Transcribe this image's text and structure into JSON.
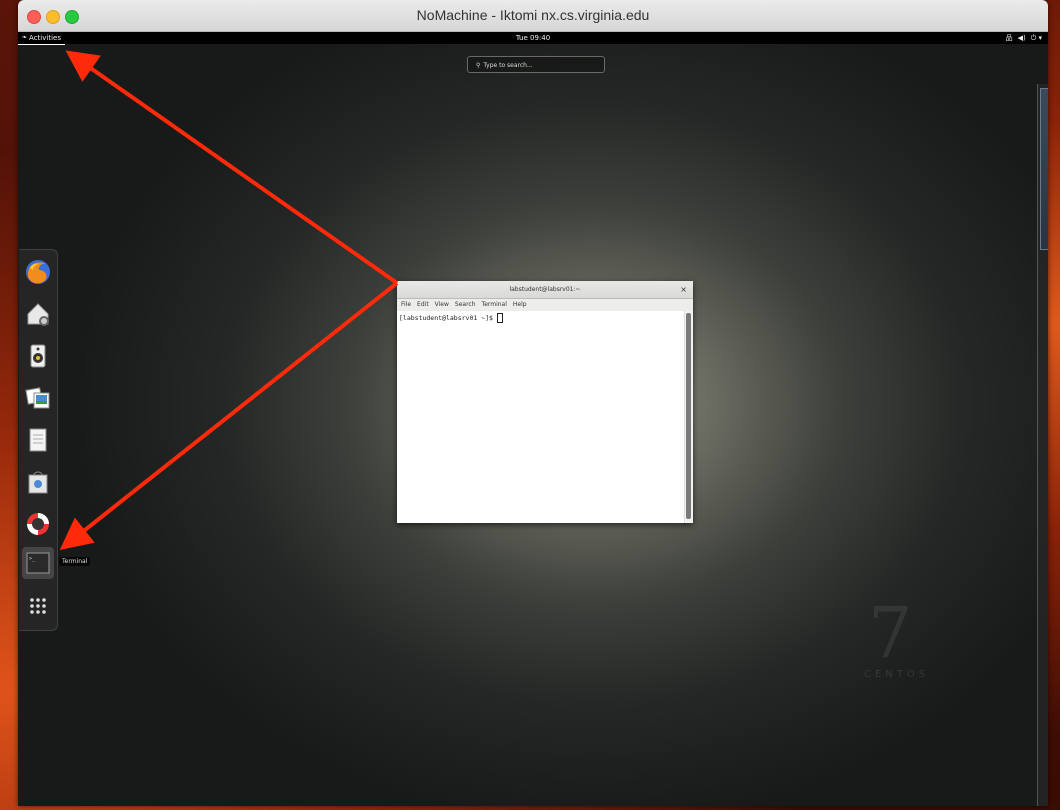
{
  "window": {
    "title": "NoMachine - Iktomi  nx.cs.virginia.edu"
  },
  "topbar": {
    "activities_label": "Activities",
    "clock": "Tue 09:40",
    "tray_icons": [
      "network-icon",
      "volume-icon",
      "power-icon"
    ]
  },
  "search": {
    "placeholder": "Type to search..."
  },
  "dash": {
    "apps": [
      "firefox",
      "network-drive",
      "rhythmbox",
      "image-viewer",
      "text-editor",
      "software-center",
      "help",
      "terminal",
      "show-applications"
    ],
    "tooltip": "Terminal"
  },
  "terminal": {
    "title": "labstudent@labsrv01:~",
    "menu": [
      "File",
      "Edit",
      "View",
      "Search",
      "Terminal",
      "Help"
    ],
    "prompt": "[labstudent@labsrv01 ~]$ "
  },
  "watermark": {
    "text": "7 CENTOS"
  },
  "annotations": {
    "arrow_color": "#ff2a0a"
  }
}
